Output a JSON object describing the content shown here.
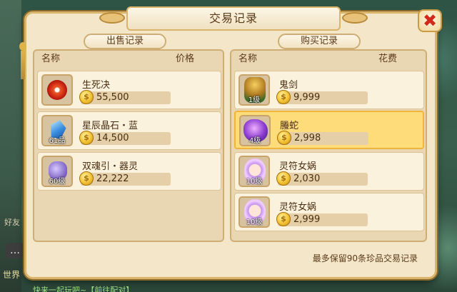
{
  "window": {
    "title": "交易记录",
    "close_label": "✖",
    "footer_note": "最多保留90条珍品交易记录"
  },
  "sell": {
    "tab_label": "出售记录",
    "col_name": "名称",
    "col_price": "价格",
    "items": [
      {
        "name": "生死决",
        "price": "55,500",
        "level": "",
        "icon": "fire-orb-icon"
      },
      {
        "name": "星辰晶石・蓝",
        "price": "14,500",
        "level": "61品",
        "icon": "blue-crystal-icon"
      },
      {
        "name": "双魂引・器灵",
        "price": "22,222",
        "level": "60级",
        "icon": "spirit-bag-icon"
      }
    ]
  },
  "buy": {
    "tab_label": "购买记录",
    "col_name": "名称",
    "col_cost": "花费",
    "items": [
      {
        "name": "鬼剑",
        "price": "9,999",
        "level": "1级",
        "icon": "ghost-sword-icon",
        "selected": false
      },
      {
        "name": "螣蛇",
        "price": "2,998",
        "level": "4级",
        "icon": "purple-serpent-icon",
        "selected": true
      },
      {
        "name": "灵符女娲",
        "price": "2,030",
        "level": "10级",
        "icon": "nuwa-icon",
        "selected": false
      },
      {
        "name": "灵符女娲",
        "price": "2,999",
        "level": "10级",
        "icon": "nuwa-icon",
        "selected": false
      }
    ]
  },
  "background": {
    "side_text": "好友",
    "chat_icon": "…",
    "world_label": "世界",
    "bottom_text": "快来一起玩吧~【前往配对】"
  },
  "colors": {
    "panel_bg": "#e9d6b2",
    "row_bg": "#fbf2dd",
    "selected_row": "#ffdc7a",
    "close_red": "#d22a1a"
  }
}
